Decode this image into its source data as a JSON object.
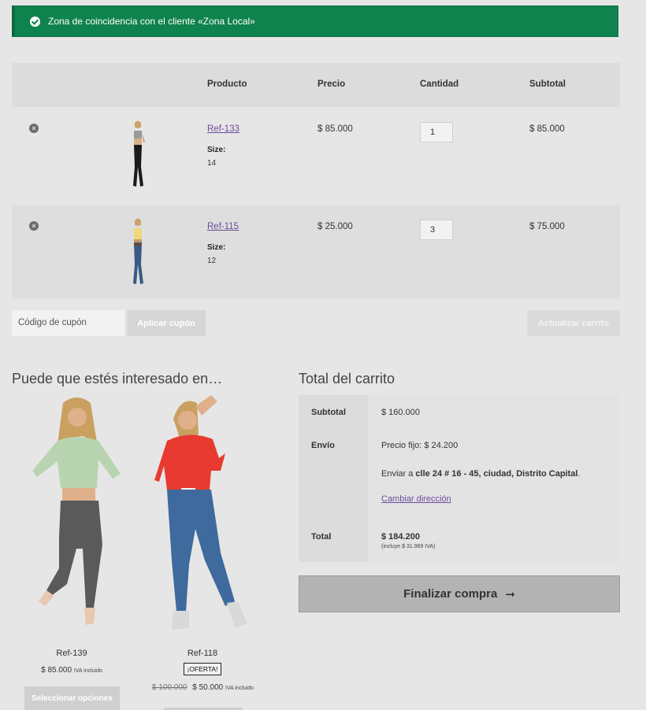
{
  "notice": {
    "text": "Zona de coincidencia con el cliente «Zona Local»"
  },
  "table": {
    "headers": [
      "Producto",
      "Precio",
      "Cantidad",
      "Subtotal"
    ],
    "rows": [
      {
        "name": "Ref-133",
        "meta_key": "Size:",
        "meta_val": "14",
        "price": "$ 85.000",
        "qty": "1",
        "subtotal": "$ 85.000"
      },
      {
        "name": "Ref-115",
        "meta_key": "Size:",
        "meta_val": "12",
        "price": "$ 25.000",
        "qty": "3",
        "subtotal": "$ 75.000"
      }
    ]
  },
  "coupon": {
    "placeholder": "Código de cupón",
    "apply_label": "Aplicar cupón"
  },
  "update_label": "Actualizar carrito",
  "related": {
    "title": "Puede que estés interesado en…",
    "products": [
      {
        "name": "Ref-139",
        "price": "$ 85.000",
        "tax": "IVA incluido",
        "button": "Seleccionar opciones"
      },
      {
        "name": "Ref-118",
        "badge": "¡OFERTA!",
        "old_price": "$ 100.000",
        "price": "$ 50.000",
        "tax": "IVA incluido"
      }
    ]
  },
  "totals": {
    "title": "Total del carrito",
    "subtotal_label": "Subtotal",
    "subtotal_value": "$ 160.000",
    "shipping_label": "Envío",
    "shipping_method": "Precio fijo: $ 24.200",
    "ship_to_prefix": "Enviar a",
    "ship_to_address": "clle 24 # 16 - 45, ciudad, Distrito Capital",
    "change_address": "Cambiar dirección",
    "total_label": "Total",
    "total_value": "$ 184.200",
    "tax_note": "(incluye $ 31.969 IVA)"
  },
  "checkout_label": "Finalizar compra",
  "colors": {
    "notice_bg": "#0f834d",
    "link": "#6c4b9c"
  }
}
